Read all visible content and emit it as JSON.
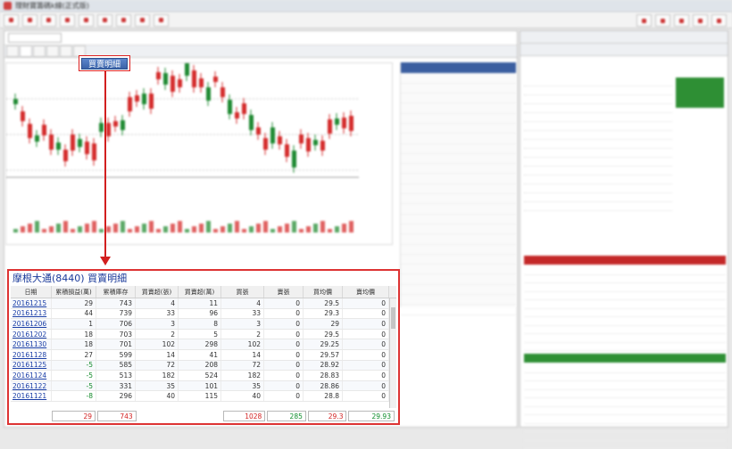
{
  "window": {
    "title": "理財寶籌碼k線(正式版)"
  },
  "callout": {
    "label": "買賣明細"
  },
  "popup": {
    "title": "摩根大通(8440) 買賣明細",
    "columns": [
      "日期",
      "累積損益(萬)",
      "累積庫存",
      "買賣超(張)",
      "買賣超(萬)",
      "買張",
      "賣張",
      "買均價",
      "賣均價"
    ],
    "rows": [
      [
        "20161215",
        "29",
        "743",
        "4",
        "11",
        "4",
        "0",
        "29.5",
        "0"
      ],
      [
        "20161213",
        "44",
        "739",
        "33",
        "96",
        "33",
        "0",
        "29.3",
        "0"
      ],
      [
        "20161206",
        "1",
        "706",
        "3",
        "8",
        "3",
        "0",
        "29",
        "0"
      ],
      [
        "20161202",
        "18",
        "703",
        "2",
        "5",
        "2",
        "0",
        "29.5",
        "0"
      ],
      [
        "20161130",
        "18",
        "701",
        "102",
        "298",
        "102",
        "0",
        "29.25",
        "0"
      ],
      [
        "20161128",
        "27",
        "599",
        "14",
        "41",
        "14",
        "0",
        "29.57",
        "0"
      ],
      [
        "20161125",
        "-5",
        "585",
        "72",
        "208",
        "72",
        "0",
        "28.92",
        "0"
      ],
      [
        "20161124",
        "-5",
        "513",
        "182",
        "524",
        "182",
        "0",
        "28.83",
        "0"
      ],
      [
        "20161122",
        "-5",
        "331",
        "35",
        "101",
        "35",
        "0",
        "28.86",
        "0"
      ],
      [
        "20161121",
        "-8",
        "296",
        "40",
        "115",
        "40",
        "0",
        "28.8",
        "0"
      ]
    ],
    "totals": {
      "pnl": "29",
      "stock": "743",
      "buy_vol": "1028",
      "sell_vol": "285",
      "buy_avg": "29.3",
      "sell_avg": "29.93"
    }
  }
}
